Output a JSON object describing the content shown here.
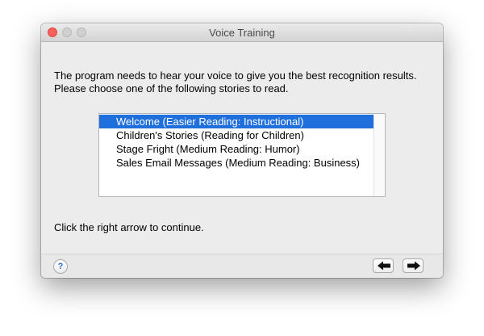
{
  "window": {
    "title": "Voice Training"
  },
  "intro": {
    "line1": "The program needs to hear your voice to give you the best recognition results.",
    "line2": "Please choose one of the following stories to read."
  },
  "stories": {
    "selected_index": 0,
    "items": [
      "Welcome (Easier Reading: Instructional)",
      "Children's Stories (Reading for Children)",
      "Stage Fright (Medium Reading: Humor)",
      "Sales Email Messages (Medium Reading: Business)"
    ]
  },
  "instruction": "Click the right arrow to continue.",
  "footer": {
    "help_label": "?",
    "help_icon": "help-icon",
    "back_icon": "arrow-left-icon",
    "forward_icon": "arrow-right-icon"
  },
  "colors": {
    "selection": "#1f6fdc",
    "close_button": "#fc605c",
    "window_bg": "#ececec"
  }
}
